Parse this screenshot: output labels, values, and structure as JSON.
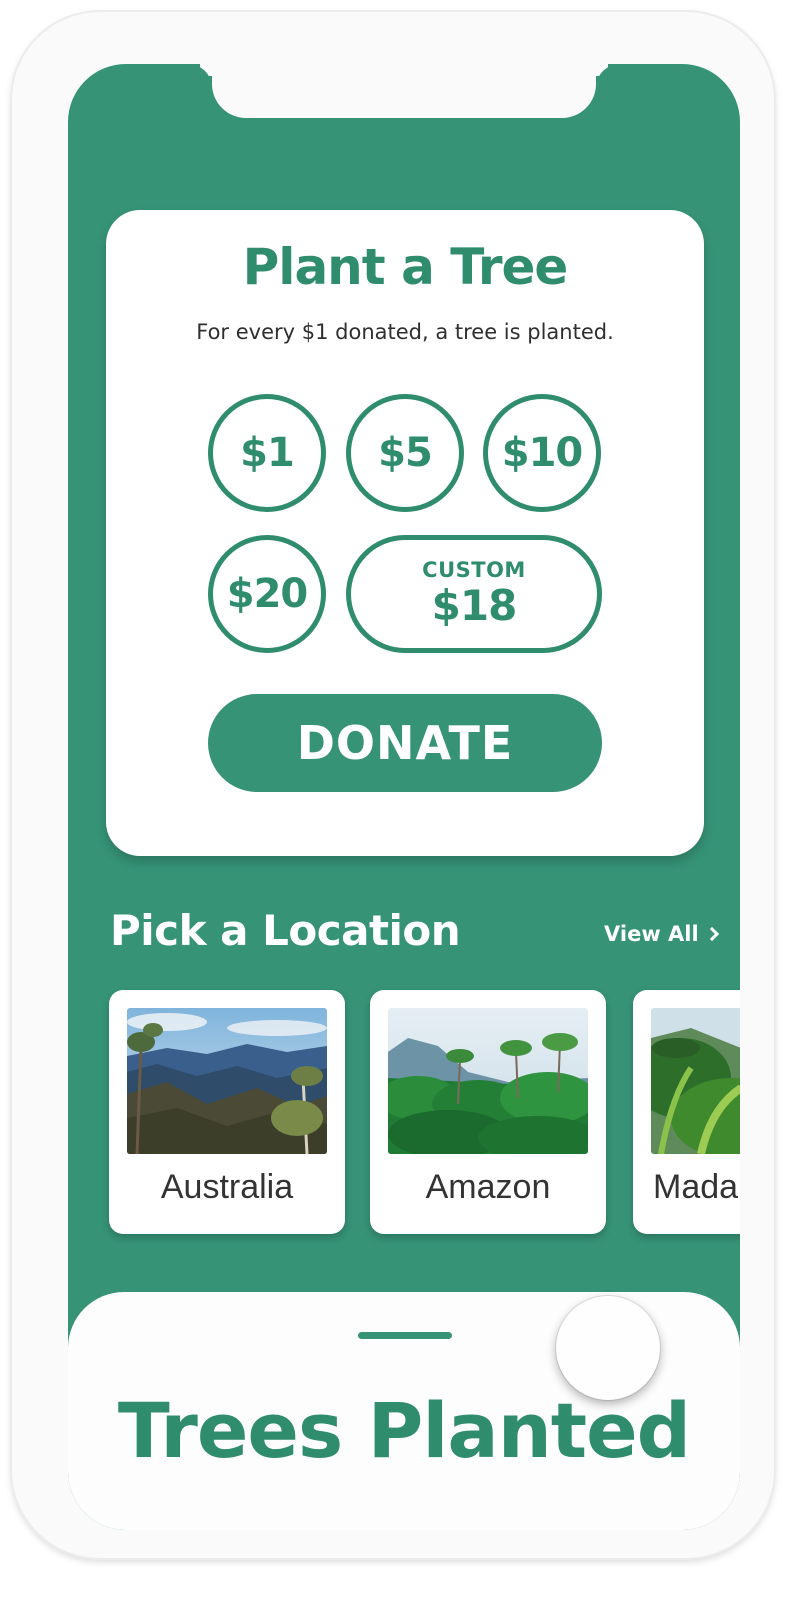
{
  "donation": {
    "title": "Plant a Tree",
    "subtitle": "For every $1 donated, a tree is planted.",
    "amounts": [
      {
        "label": "$1"
      },
      {
        "label": "$5"
      },
      {
        "label": "$10"
      },
      {
        "label": "$20"
      }
    ],
    "custom": {
      "label": "CUSTOM",
      "value": "$18"
    },
    "donate_label": "DONATE"
  },
  "locations": {
    "title": "Pick a Location",
    "view_all_label": "View All",
    "view_all_icon": "chevron-right-icon",
    "items": [
      {
        "name": "Australia"
      },
      {
        "name": "Amazon"
      },
      {
        "name": "Mada"
      }
    ]
  },
  "bottom_sheet": {
    "title": "Trees Planted"
  },
  "colors": {
    "brand_green": "#369376",
    "text_green": "#2f8d6d",
    "card_background": "#ffffff"
  }
}
